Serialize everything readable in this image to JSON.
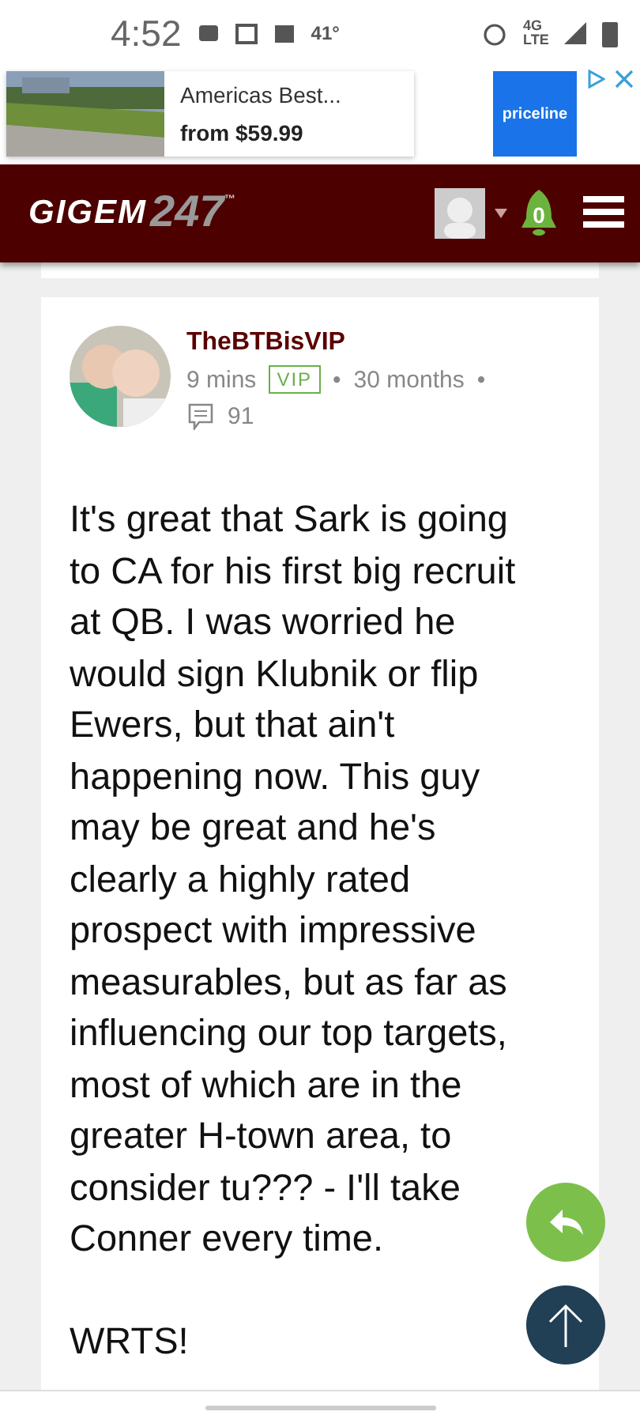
{
  "status_bar": {
    "time": "4:52",
    "temperature": "41°",
    "network": "4G LTE"
  },
  "ad": {
    "title": "Americas Best...",
    "price": "from $59.99",
    "brand": "priceline"
  },
  "header": {
    "logo_main": "GIGEM",
    "logo_number": "247",
    "logo_mark": "™",
    "notifications": "0"
  },
  "post": {
    "author": "TheBTBisVIP",
    "time": "9 mins",
    "badge": "VIP",
    "tenure": "30 months",
    "separator": "•",
    "post_count": "91",
    "body": [
      "It's great that Sark is going to CA for his first big recruit at QB. I was worried he would sign Klubnik or flip Ewers, but that ain't happening now. This guy may be great and he's clearly a highly rated prospect with impressive measurables, but as far as influencing our top targets, most of which are in the greater H-town area, to consider tu??? - I'll take Conner every time.",
      "WRTS!"
    ]
  }
}
